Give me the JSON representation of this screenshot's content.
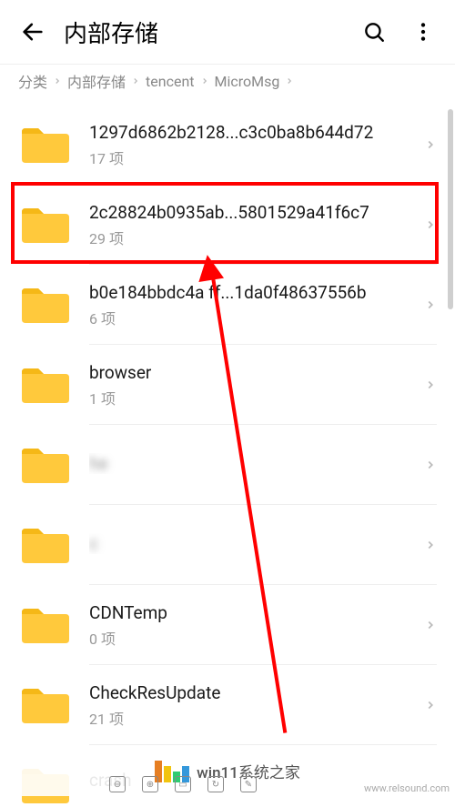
{
  "header": {
    "title": "内部存储"
  },
  "breadcrumb": {
    "items": [
      "分类",
      "内部存储",
      "tencent",
      "MicroMsg"
    ]
  },
  "folders": [
    {
      "name": "1297d6862b2128...c3c0ba8b644d72",
      "sub": "17 项"
    },
    {
      "name": "2c28824b0935ab...5801529a41f6c7",
      "sub": "29 项"
    },
    {
      "name": "b0e184bbdc4a  ff...1da0f48637556b",
      "sub": "6 项"
    },
    {
      "name": "browser",
      "sub": "1 项"
    },
    {
      "name": "     he",
      "sub": " "
    },
    {
      "name": "c       ",
      "sub": "  "
    },
    {
      "name": "CDNTemp",
      "sub": "0 项"
    },
    {
      "name": "CheckResUpdate",
      "sub": "21 项"
    },
    {
      "name": "crash",
      "sub": ""
    }
  ],
  "watermark": {
    "text": "win11系统之家",
    "url": "www.relsound.com"
  }
}
